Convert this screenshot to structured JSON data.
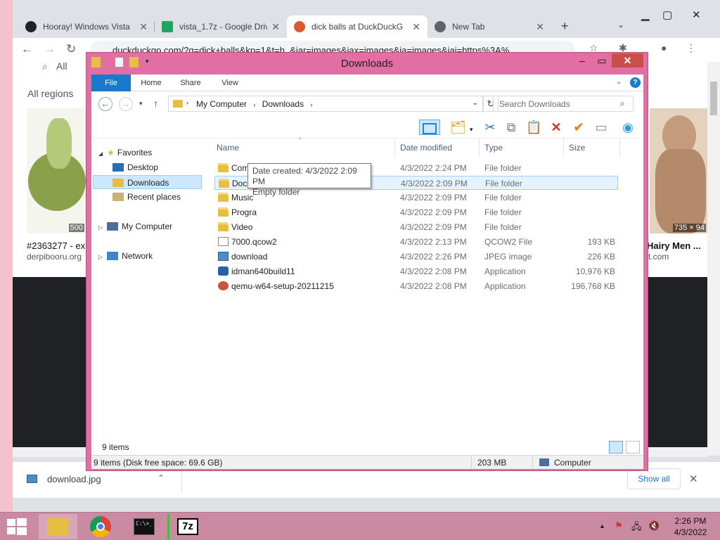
{
  "browser": {
    "tabs": [
      {
        "title": "Hooray! Windows Vista",
        "icon": "github-icon",
        "color": "#1f2328"
      },
      {
        "title": "vista_1.7z - Google Driv",
        "icon": "google-drive-icon",
        "color": "#1fa463"
      },
      {
        "title": "dick balls at DuckDuckG",
        "icon": "duckduckgo-icon",
        "color": "#de5833"
      },
      {
        "title": "New Tab",
        "icon": "chrome-icon",
        "color": "#5f6368"
      }
    ],
    "url": "duckduckgo.com/?q=dick+balls&kp=1&t=h_&iar=images&iax=images&ia=images&iai=https%3A%",
    "page": {
      "all_label": "All",
      "region_label": "All regions",
      "left_card": {
        "badge": "500",
        "title": "#2363277 - ex",
        "source": "derpibooru.org"
      },
      "right_card": {
        "badge": "735 × 94",
        "title": "Hairy Men ...",
        "source": "t.com"
      }
    },
    "download": {
      "file": "download.jpg",
      "show_all": "Show all"
    }
  },
  "explorer": {
    "title": "Downloads",
    "ribbon_tabs": [
      "File",
      "Home",
      "Share",
      "View"
    ],
    "breadcrumb": [
      "My Computer",
      "Downloads"
    ],
    "search_placeholder": "Search Downloads",
    "columns": [
      "Name",
      "Date modified",
      "Type",
      "Size"
    ],
    "nav": {
      "favorites": "Favorites",
      "desktop": "Desktop",
      "downloads": "Downloads",
      "recent": "Recent places",
      "computer": "My Computer",
      "network": "Network"
    },
    "files": [
      {
        "name": "Compressed",
        "date": "4/3/2022 2:24 PM",
        "type": "File folder",
        "size": "",
        "kind": "folder"
      },
      {
        "name": "Documents",
        "date": "4/3/2022 2:09 PM",
        "type": "File folder",
        "size": "",
        "kind": "folder"
      },
      {
        "name": "Music",
        "date": "4/3/2022 2:09 PM",
        "type": "File folder",
        "size": "",
        "kind": "folder"
      },
      {
        "name": "Progra",
        "date": "4/3/2022 2:09 PM",
        "type": "File folder",
        "size": "",
        "kind": "folder"
      },
      {
        "name": "Video",
        "date": "4/3/2022 2:09 PM",
        "type": "File folder",
        "size": "",
        "kind": "folder"
      },
      {
        "name": "7000.qcow2",
        "date": "4/3/2022 2:13 PM",
        "type": "QCOW2 File",
        "size": "193 KB",
        "kind": "file"
      },
      {
        "name": "download",
        "date": "4/3/2022 2:26 PM",
        "type": "JPEG image",
        "size": "226 KB",
        "kind": "jpg"
      },
      {
        "name": "idman640build11",
        "date": "4/3/2022 2:08 PM",
        "type": "Application",
        "size": "10,976 KB",
        "kind": "app"
      },
      {
        "name": "qemu-w64-setup-20211215",
        "date": "4/3/2022 2:08 PM",
        "type": "Application",
        "size": "196,768 KB",
        "kind": "qemu"
      }
    ],
    "tooltip": {
      "line1": "Date created: 4/3/2022 2:09 PM",
      "line2": "Empty folder"
    },
    "item_count": "9 items",
    "status": {
      "left": "9 items (Disk free space: 69.6 GB)",
      "size": "203 MB",
      "location": "Computer"
    }
  },
  "taskbar": {
    "terminal_text": "C:\\>_",
    "sevenzip_text": "7z",
    "time": "2:26 PM",
    "date": "4/3/2022"
  }
}
